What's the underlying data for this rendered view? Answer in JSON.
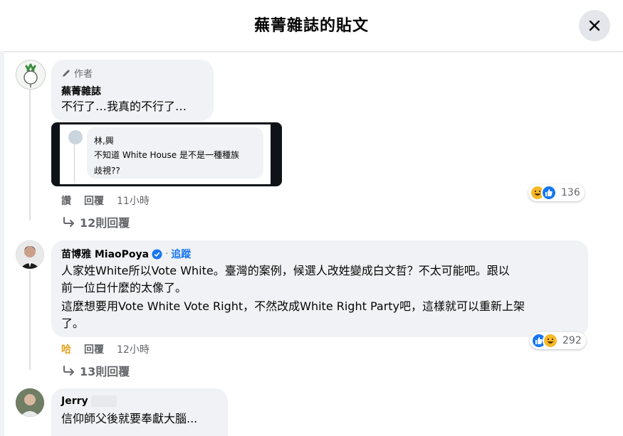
{
  "header": {
    "title": "蕪菁雜誌的貼文"
  },
  "comments": [
    {
      "author_badge": "作者",
      "author": "蕪菁雜誌",
      "text": "不行了…我真的不行了…",
      "embedded": {
        "name": "林,興",
        "text_line1": "不知道 White House  是不是一種種族",
        "text_line2": "歧視??"
      },
      "actions": {
        "like": "讚",
        "reply": "回覆",
        "time": "11小時"
      },
      "reactions": {
        "count": "136",
        "icons": [
          "haha-icon",
          "like-icon"
        ]
      },
      "view_replies": "12則回覆"
    },
    {
      "author": "苗博雅 MiaoPoya",
      "follow": "追蹤",
      "separator": "·",
      "text_line1": "人家姓White所以Vote White。臺灣的案例，候選人改姓變成白文哲？不太可能吧。跟以",
      "text_line2": "前一位白什麼的太像了。",
      "text_line3": "這麼想要用Vote White Vote Right，不然改成White Right Party吧，這樣就可以重新上架",
      "text_line4": "了。",
      "actions": {
        "like": "哈",
        "reply": "回覆",
        "time": "12小時"
      },
      "reactions": {
        "count": "292",
        "icons": [
          "like-icon",
          "haha-icon"
        ]
      },
      "view_replies": "13則回覆"
    },
    {
      "author": "Jerry",
      "text": "信仰師父後就要奉獻大腦..."
    }
  ],
  "colors": {
    "like": "#1877f2",
    "haha": "#f7b928",
    "verified": "#1877f2"
  }
}
